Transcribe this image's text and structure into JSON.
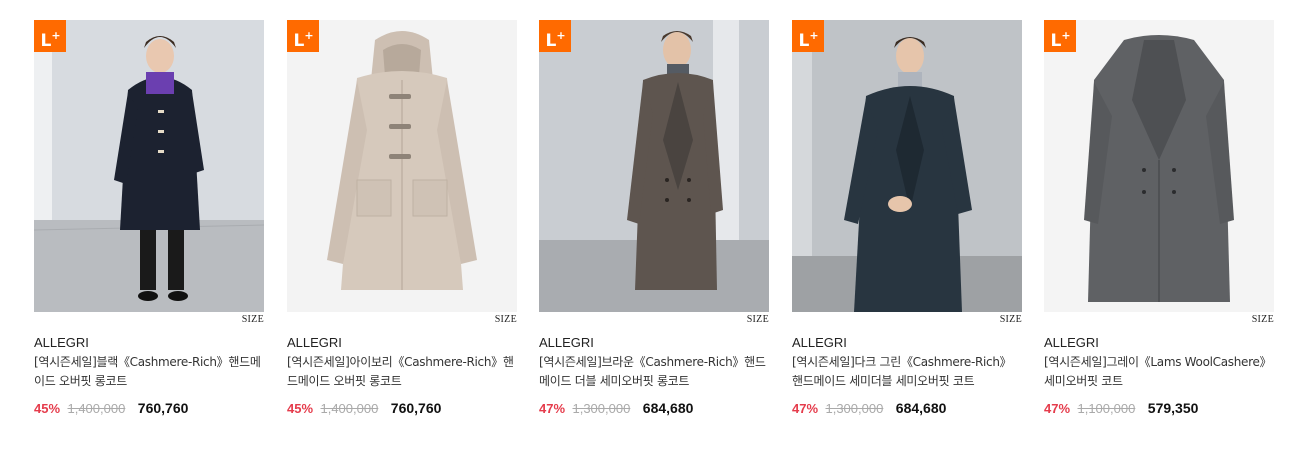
{
  "badge_label": "L",
  "badge_plus": "+",
  "size_label": "SIZE",
  "products": [
    {
      "brand": "ALLEGRI",
      "name": "[역시즌세일]블랙《Cashmere-Rich》핸드메이드 오버핏 롱코트",
      "discount": "45%",
      "original_price": "1,400,000",
      "sale_price": "760,760"
    },
    {
      "brand": "ALLEGRI",
      "name": "[역시즌세일]아이보리《Cashmere-Rich》핸드메이드 오버핏 롱코트",
      "discount": "45%",
      "original_price": "1,400,000",
      "sale_price": "760,760"
    },
    {
      "brand": "ALLEGRI",
      "name": "[역시즌세일]브라운《Cashmere-Rich》핸드메이드 더블 세미오버핏 롱코트",
      "discount": "47%",
      "original_price": "1,300,000",
      "sale_price": "684,680"
    },
    {
      "brand": "ALLEGRI",
      "name": "[역시즌세일]다크 그린《Cashmere-Rich》핸드메이드 세미더블 세미오버핏 코트",
      "discount": "47%",
      "original_price": "1,300,000",
      "sale_price": "684,680"
    },
    {
      "brand": "ALLEGRI",
      "name": "[역시즌세일]그레이《Lams WoolCashere》세미오버핏 코트",
      "discount": "47%",
      "original_price": "1,100,000",
      "sale_price": "579,350"
    }
  ],
  "colors": {
    "badge": "#ff6a00",
    "discount": "#e53c4c",
    "original_price": "#aaaaaa"
  }
}
